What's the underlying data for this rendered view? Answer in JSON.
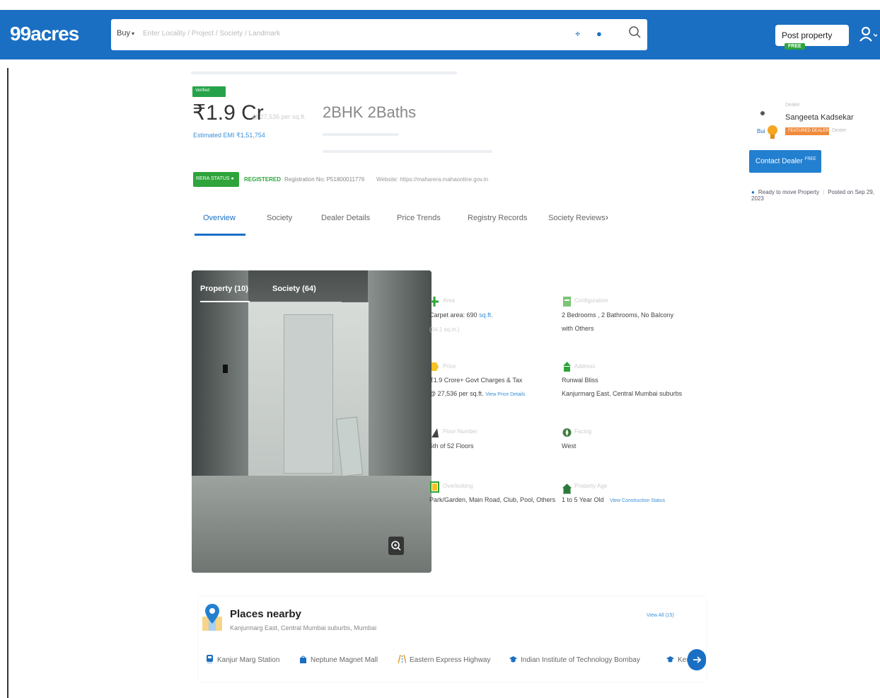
{
  "header": {
    "logo": "99acres",
    "search": {
      "mode": "Buy",
      "placeholder": "Enter Locality / Project / Society / Landmark"
    },
    "post_property": "Post property",
    "post_badge": "FREE"
  },
  "listing": {
    "verified": "Verified",
    "price": "₹1.9 Cr",
    "price_sub": "@ 27,536 per sq.ft.",
    "config": "2BHK 2Baths",
    "emi": "Estimated EMI ₹1,51,754",
    "rera_status": "RERA STATUS",
    "registered": "REGISTERED",
    "registration_no": "Registration No: P51800011776",
    "website": "Website: https://maharera.mahaonline.gov.in"
  },
  "tabs": [
    {
      "label": "Overview",
      "active": true
    },
    {
      "label": "Society"
    },
    {
      "label": "Dealer Details"
    },
    {
      "label": "Price Trends"
    },
    {
      "label": "Registry Records"
    },
    {
      "label": "Society Reviews"
    }
  ],
  "agent": {
    "tag": "Dealer",
    "name": "Sangeeta Kadsekar",
    "badge": "FEATURED DEALER",
    "meta": "Dealer",
    "contact": "Contact Dealer",
    "contact_badge": "FREE",
    "ready": "Ready to move Property",
    "posted": "Posted on Sep 29, 2023"
  },
  "photo": {
    "tab_property": "Property (10)",
    "tab_society": "Society (64)"
  },
  "details": {
    "area_label": "Area",
    "area_value": "Carpet area: 690",
    "area_unit": "sq.ft.",
    "area_sub": "(64.1 sq.m.)",
    "config_label": "Configuration",
    "config_value_1": "2 Bedrooms , 2 Bathrooms, No Balcony",
    "config_value_2": "with Others",
    "price_label": "Price",
    "price_value_1": "₹1.9 Crore+ Govt Charges & Tax",
    "price_value_2": "@ 27,536 per sq.ft.",
    "price_link": "View Price Details",
    "address_label": "Address",
    "address_value_1": "Runwal Bliss",
    "address_value_2": "Kanjurmarg East, Central Mumbai suburbs",
    "floor_label": "Floor Number",
    "floor_value": "5th  of 52 Floors",
    "facing_label": "Facing",
    "facing_value": "West",
    "overlooking_label": "Overlooking",
    "overlooking_value": "Park/Garden, Main Road, Club, Pool, Others",
    "age_label": "Property Age",
    "age_value": "1 to 5 Year Old",
    "age_link": "View Construction Status"
  },
  "places": {
    "title": "Places nearby",
    "subtitle": "Kanjurmarg East, Central Mumbai suburbs, Mumbai",
    "view_all": "View All (15)",
    "items": [
      {
        "label": "Kanjur Marg Station",
        "icon": "train-icon",
        "color": "#1a6fc3"
      },
      {
        "label": "Neptune Magnet Mall",
        "icon": "shopping-bag-icon",
        "color": "#1a6fc3"
      },
      {
        "label": "Eastern Express Highway",
        "icon": "highway-icon",
        "color": "#e0a020"
      },
      {
        "label": "Indian Institute of Technology Bombay",
        "icon": "graduation-cap-icon",
        "color": "#1a6fc3"
      },
      {
        "label": "Kendriya Vidyalaya",
        "icon": "graduation-cap-icon",
        "color": "#1a6fc3"
      }
    ]
  },
  "colors": {
    "brand_blue": "#1a6fc3",
    "green": "#2ea43b",
    "orange": "#f08a3c"
  }
}
